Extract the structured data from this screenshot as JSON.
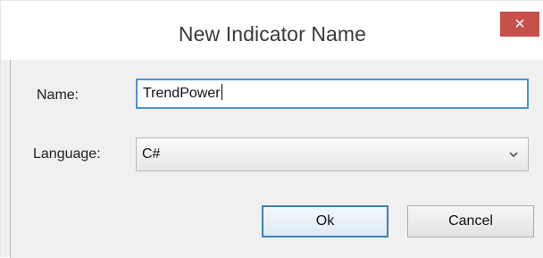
{
  "dialog": {
    "title": "New Indicator Name",
    "close_label": "×"
  },
  "form": {
    "name_label": "Name:",
    "name_value": "TrendPower",
    "language_label": "Language:",
    "language_value": "C#"
  },
  "buttons": {
    "ok_label": "Ok",
    "cancel_label": "Cancel"
  }
}
